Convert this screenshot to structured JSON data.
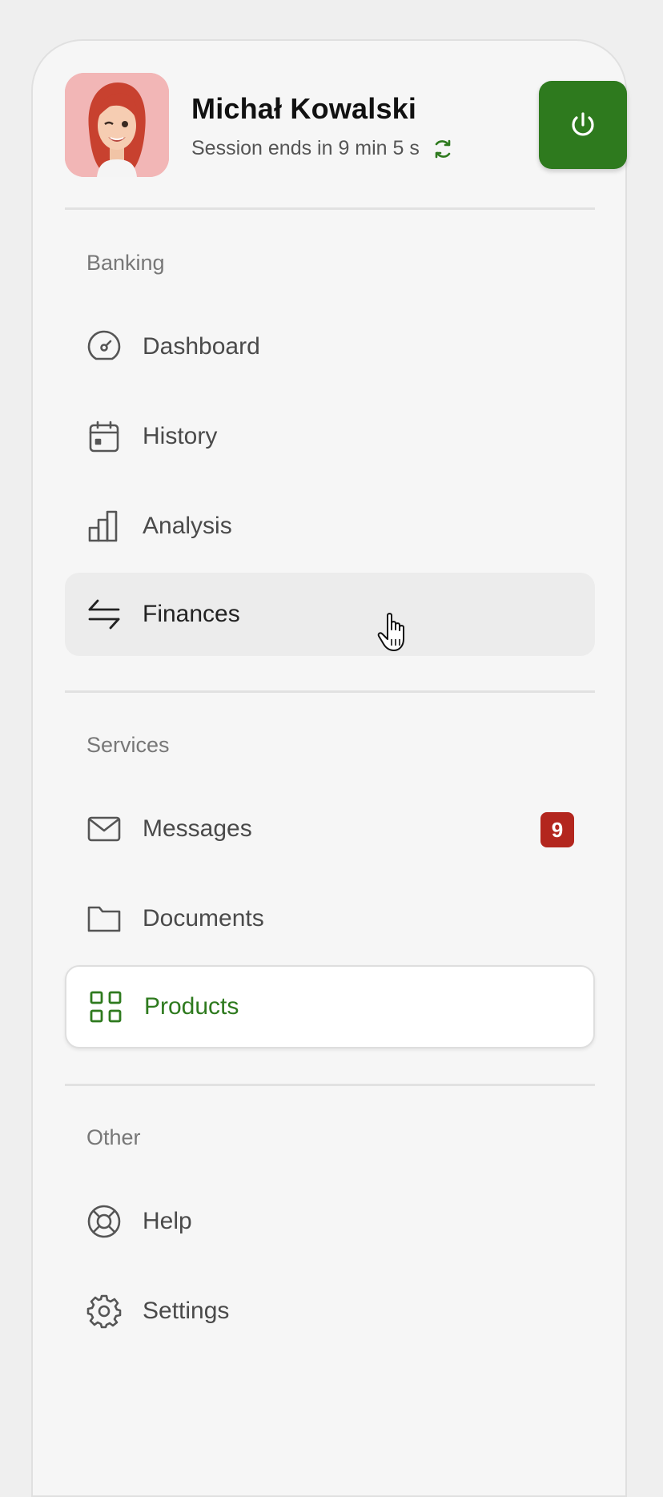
{
  "user": {
    "name": "Michał Kowalski",
    "session_text": "Session ends in 9 min 5 s"
  },
  "colors": {
    "accent": "#2e7a1e",
    "badge": "#b3261e",
    "avatar_bg": "#f2b6b6"
  },
  "sections": {
    "banking": {
      "label": "Banking",
      "items": [
        {
          "label": "Dashboard",
          "icon": "gauge-icon"
        },
        {
          "label": "History",
          "icon": "calendar-icon"
        },
        {
          "label": "Analysis",
          "icon": "bar-chart-icon"
        },
        {
          "label": "Finances",
          "icon": "transfer-arrows-icon",
          "state": "hover"
        }
      ]
    },
    "services": {
      "label": "Services",
      "items": [
        {
          "label": "Messages",
          "icon": "envelope-icon",
          "badge": "9"
        },
        {
          "label": "Documents",
          "icon": "folder-icon"
        },
        {
          "label": "Products",
          "icon": "grid-icon",
          "state": "active"
        }
      ]
    },
    "other": {
      "label": "Other",
      "items": [
        {
          "label": "Help",
          "icon": "lifebuoy-icon"
        },
        {
          "label": "Settings",
          "icon": "gear-icon"
        }
      ]
    }
  }
}
